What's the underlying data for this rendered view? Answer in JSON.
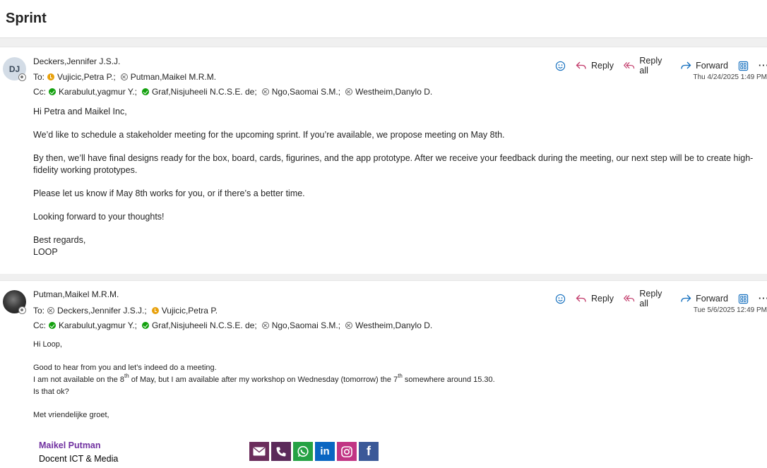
{
  "thread": {
    "title": "Sprint"
  },
  "actions": {
    "reply": "Reply",
    "reply_all": "Reply all",
    "forward": "Forward",
    "more": "···"
  },
  "messages": [
    {
      "initials": "DJ",
      "sender": "Deckers,Jennifer J.S.J.",
      "to_label": "To:",
      "cc_label": "Cc:",
      "to": [
        {
          "name": "Vujicic,Petra P.;",
          "status": "away"
        },
        {
          "name": "Putman,Maikel M.R.M.",
          "status": "offline"
        }
      ],
      "cc": [
        {
          "name": "Karabulut,yagmur Y.;",
          "status": "available"
        },
        {
          "name": "Graf,Nisjuheeli N.C.S.E. de;",
          "status": "available"
        },
        {
          "name": "Ngo,Saomai S.M.;",
          "status": "offline"
        },
        {
          "name": "Westheim,Danylo D.",
          "status": "offline"
        }
      ],
      "timestamp": "Thu 4/24/2025 1:49 PM",
      "body": [
        "Hi Petra and Maikel Inc,",
        "We’d like to schedule a stakeholder meeting for the upcoming sprint. If you’re available, we propose meeting on May 8th.",
        "By then, we’ll have final designs ready for the box, board, cards, figurines, and the app prototype. After we receive your feedback during the meeting, our next step will be to create high-fidelity working prototypes.",
        "Please let us know if May 8th works for you, or if there’s a better time.",
        "Looking forward to your thoughts!",
        "Best regards,",
        "LOOP"
      ]
    },
    {
      "sender": "Putman,Maikel M.R.M.",
      "to_label": "To:",
      "cc_label": "Cc:",
      "to": [
        {
          "name": "Deckers,Jennifer J.S.J.;",
          "status": "offline"
        },
        {
          "name": "Vujicic,Petra P.",
          "status": "away"
        }
      ],
      "cc": [
        {
          "name": "Karabulut,yagmur Y.;",
          "status": "available"
        },
        {
          "name": "Graf,Nisjuheeli N.C.S.E. de;",
          "status": "available"
        },
        {
          "name": "Ngo,Saomai S.M.;",
          "status": "offline"
        },
        {
          "name": "Westheim,Danylo D.",
          "status": "offline"
        }
      ],
      "timestamp": "Tue 5/6/2025 12:49 PM",
      "greeting": "Hi Loop,",
      "line1": "Good to hear from you and let’s indeed do a meeting.",
      "line2_a": "I am not available on the 8",
      "line2_sup1": "th",
      "line2_b": " of May, but I am available after my workshop on Wednesday (tomorrow) the 7",
      "line2_sup2": "th",
      "line2_c": " somewhere around 15.30.",
      "line3": "Is that ok?",
      "closing": "Met vriendelijke groet,",
      "signature_name": "Maikel Putman",
      "signature_role": "Docent ICT & Media",
      "social_icons": [
        "email-icon",
        "phone-icon",
        "whatsapp-icon",
        "linkedin-icon",
        "instagram-icon",
        "facebook-icon"
      ]
    }
  ]
}
